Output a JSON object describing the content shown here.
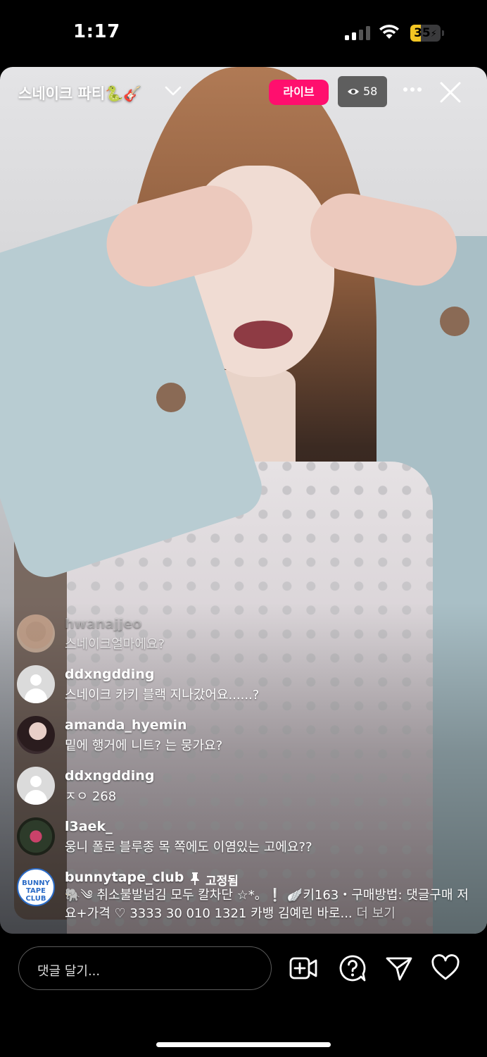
{
  "status_bar": {
    "time": "1:17",
    "battery_level": "35",
    "battery_color": "#f3c623",
    "icons": [
      "cellular-signal-icon",
      "wifi-icon",
      "battery-charging-icon"
    ]
  },
  "live": {
    "title": "스네이크 파티🐍🎸",
    "badge_label": "라이브",
    "badge_color": "#ff0f6e",
    "viewer_count": "58"
  },
  "comments": [
    {
      "user": "hwanajjeo",
      "text": "스네이크얼마에요?"
    },
    {
      "user": "ddxngdding",
      "text": "스네이크 카키 블랙 지나갔어요......?"
    },
    {
      "user": "amanda_hyemin",
      "text": "밑에 행거에 니트? 는 뭉가요?"
    },
    {
      "user": "ddxngdding",
      "text": "ㅈㅇ 268"
    },
    {
      "user": "l3aek_",
      "text": "웅니 폴로 블루종 목 쪽에도 이염있는 고에요??"
    }
  ],
  "pinned_comment": {
    "user": "bunnytape_club",
    "pinned_label": "고정됨",
    "avatar_text": "BUNNY TAPE CLUB",
    "text": "🐘༄ 취소불발넘김 모두 칼차단 ☆*。❕ 🪽키163・구매방법: 댓글구매 저요+가격 ♡ 3333 30 010 1321 카뱅 김예린 바로...",
    "more_label": "더 보기"
  },
  "bottom_bar": {
    "input_placeholder": "댓글 달기...",
    "icons": [
      "add-video-icon",
      "question-icon",
      "send-icon",
      "heart-icon"
    ]
  }
}
